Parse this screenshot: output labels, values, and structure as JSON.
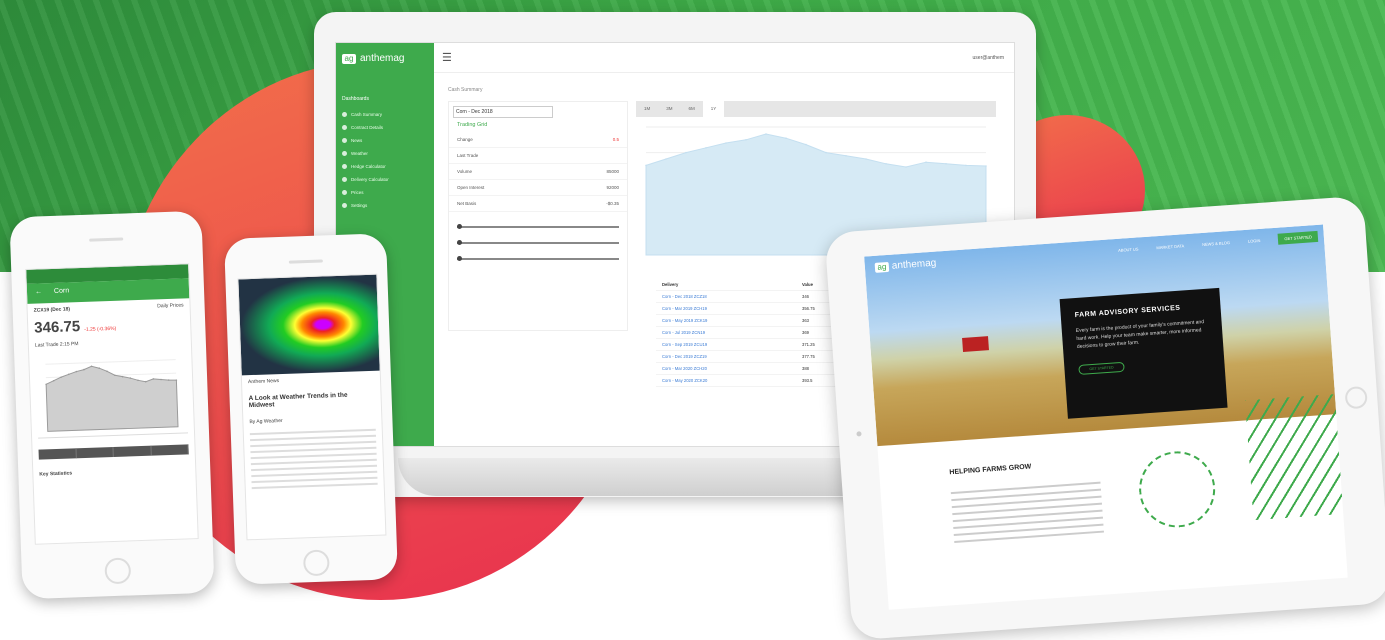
{
  "laptop": {
    "brand": "anthemag",
    "nav_heading": "Dashboards",
    "nav_items": [
      "Cash Summary",
      "Contract Details",
      "News",
      "Weather",
      "Hedge Calculator",
      "Delivery Calculator",
      "Prices",
      "Settings"
    ],
    "user_label": "user@anthem",
    "breadcrumb": "Cash Summary",
    "selector": "Corn - Dec 2018",
    "panel_title": "Trading Grid",
    "rows": [
      {
        "label": "Change",
        "value": "0.5"
      },
      {
        "label": "Last Trade",
        "value": ""
      },
      {
        "label": "Volume",
        "value": "85000"
      },
      {
        "label": "Open Interest",
        "value": "92000"
      },
      {
        "label": "Net Basis",
        "value": "-$0.35"
      }
    ],
    "tabs": [
      "1M",
      "3M",
      "6M",
      "1Y"
    ],
    "active_tab": "1Y",
    "table_headers": [
      "Delivery",
      "Value"
    ],
    "table_rows": [
      [
        "Corn - Dec 2018 ZCZ18",
        "346"
      ],
      [
        "Corn - Mar 2019 ZCH19",
        "356.75"
      ],
      [
        "Corn - May 2019 ZCK19",
        "363"
      ],
      [
        "Corn - Jul 2019 ZCN19",
        "369"
      ],
      [
        "Corn - Sep 2019 ZCU19",
        "371.25"
      ],
      [
        "Corn - Dec 2019 ZCZ19",
        "377.75"
      ],
      [
        "Corn - Mar 2020 ZCH20",
        "388"
      ],
      [
        "Corn - May 2020 ZCK20",
        "393.5"
      ]
    ]
  },
  "phone1": {
    "title": "Corn",
    "contract": "ZCX19 (Dec 18)",
    "range_label": "Daily Prices",
    "price": "346.75",
    "change": "-1.25 (-0.36%)",
    "subtext": "Last Trade 2:15 PM",
    "periods": [
      "1D",
      "5D",
      "1M",
      "6M"
    ],
    "stats_title": "Key Statistics"
  },
  "phone2": {
    "source": "Anthem News",
    "headline": "A Look at Weather Trends in the Midwest",
    "byline": "By Ag Weather"
  },
  "tablet": {
    "brand": "anthemag",
    "nav": [
      "ABOUT US",
      "MARKET DATA",
      "NEWS & BLOG",
      "LOGIN"
    ],
    "cta": "GET STARTED",
    "card_title": "FARM ADVISORY SERVICES",
    "card_text": "Every farm is the product of your family's commitment and hard work. Help your team make smarter, more informed decisions to grow their farm.",
    "card_button": "GET STARTED",
    "section_title": "HELPING FARMS GROW",
    "accent": "#3eaa4c"
  },
  "colors": {
    "brand_green": "#3eaa4c",
    "bg_red": "#e8304f",
    "bg_orange": "#f2704a"
  },
  "chart_data": {
    "type": "area",
    "title": "",
    "x": [
      1,
      2,
      3,
      4,
      5,
      6,
      7,
      8,
      9,
      10,
      11,
      12,
      13,
      14,
      15,
      16,
      17,
      18
    ],
    "values": [
      280,
      300,
      320,
      335,
      350,
      360,
      378,
      365,
      345,
      320,
      310,
      300,
      285,
      275,
      290,
      285,
      280,
      278
    ],
    "ylim": [
      0,
      400
    ]
  }
}
